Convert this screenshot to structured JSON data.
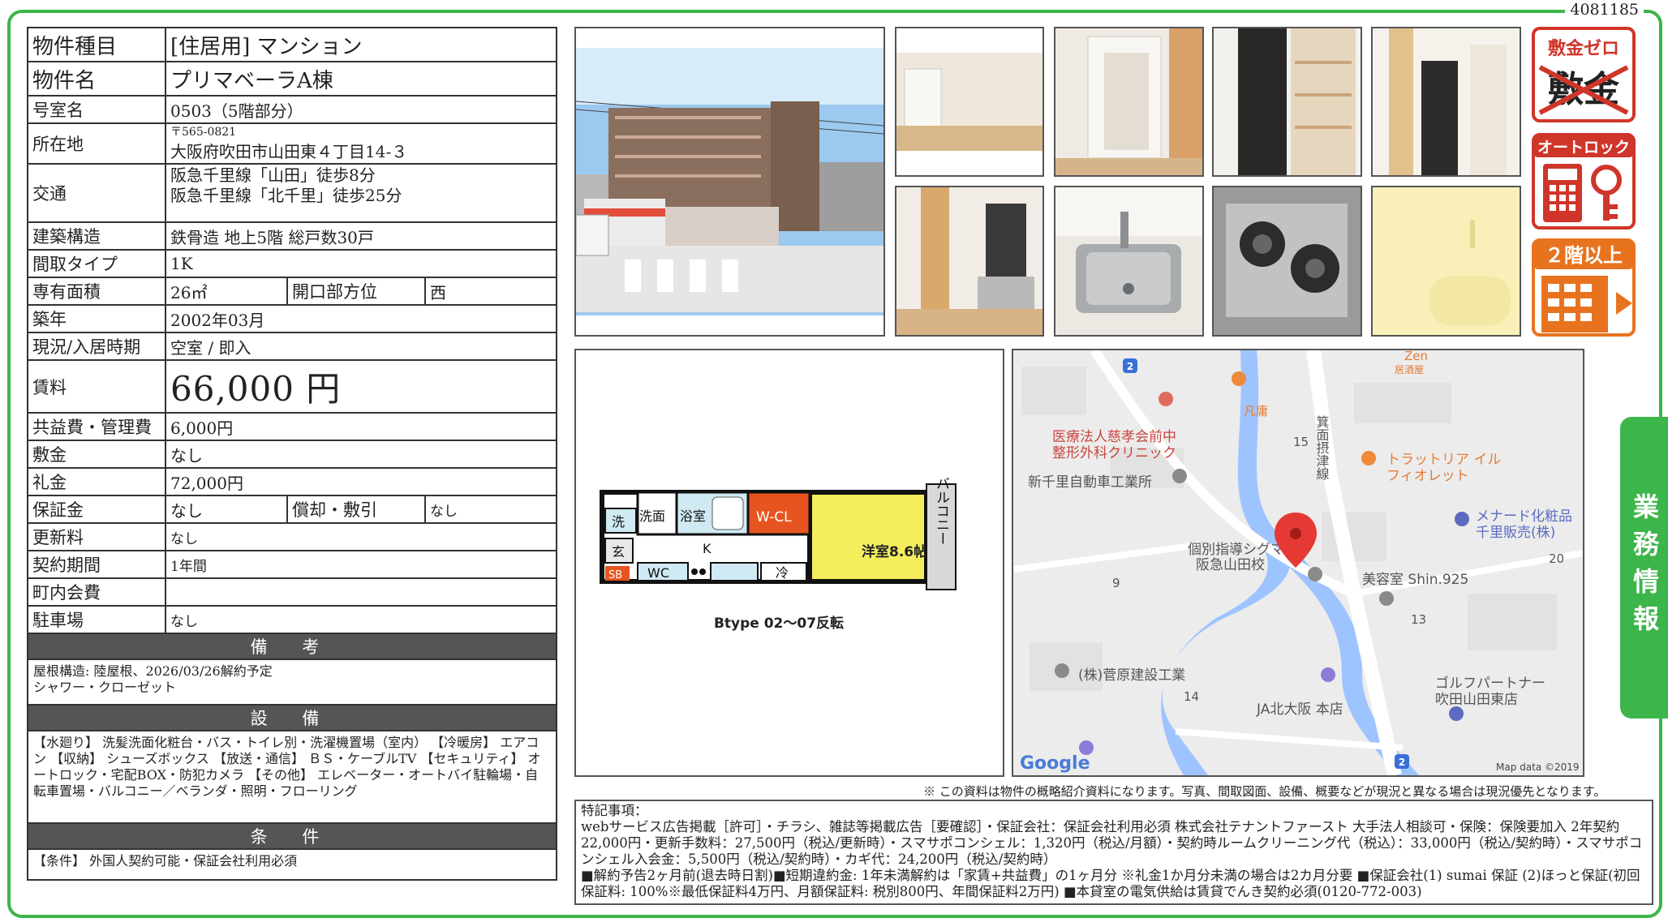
{
  "doc_id": "4081185",
  "property": {
    "type_label": "物件種目",
    "type_value": "[住居用]  マンション",
    "name_label": "物件名",
    "name_value": "プリマベーラA棟",
    "room_label": "号室名",
    "room_value": "0503（5階部分）",
    "address_label": "所在地",
    "address_zip": "〒565-0821",
    "address_value": "大阪府吹田市山田東４丁目14-３",
    "access_label": "交通",
    "access_line1": "阪急千里線「山田」徒歩8分",
    "access_line2": "阪急千里線「北千里」徒歩25分",
    "structure_label": "建築構造",
    "structure_value": "鉄骨造  地上5階  総戸数30戸",
    "layout_label": "間取タイプ",
    "layout_value": "1K",
    "area_label": "専有面積",
    "area_value": "26㎡",
    "opening_label": "開口部方位",
    "opening_value": "西",
    "built_label": "築年",
    "built_value": "2002年03月",
    "status_label": "現況/入居時期",
    "status_value": "空室  /  即入",
    "rent_label": "賃料",
    "rent_value": "66,000  円",
    "fee_label": "共益費・管理費",
    "fee_value": "6,000円",
    "deposit_label": "敷金",
    "deposit_value": "なし",
    "keymoney_label": "礼金",
    "keymoney_value": "72,000円",
    "guarantee_label": "保証金",
    "guarantee_value": "なし",
    "amort_label": "償却・敷引",
    "amort_value": "なし",
    "renewal_label": "更新料",
    "renewal_value": "なし",
    "contract_label": "契約期間",
    "contract_value": "1年間",
    "assoc_label": "町内会費",
    "assoc_value": "",
    "parking_label": "駐車場",
    "parking_value": "なし"
  },
  "remarks": {
    "heading": "備 考",
    "line1": "屋根構造:  陸屋根、2026/03/26解約予定",
    "line2": "シャワー・クローゼット"
  },
  "equipment": {
    "heading": "設 備",
    "text": "【水廻り】 洗髪洗面化粧台・バス・トイレ別・洗濯機置場（室内）  【冷暖房】 エアコン  【収納】 シューズボックス  【放送・通信】 ＢＳ・ケーブルTV 【セキュリティ】 オートロック・宅配BOX・防犯カメラ  【その他】 エレベーター・オートバイ駐輪場・自転車置場・バルコニー／ベランダ・照明・フローリング"
  },
  "conditions": {
    "heading": "条 件",
    "text": "【条件】  外国人契約可能・保証会社利用必須"
  },
  "badges": {
    "deposit_zero": "敷金ゼロ",
    "deposit_word": "敷金",
    "autolock": "オートロック",
    "floor": "２階以上"
  },
  "floorplan": {
    "caption": "Btype 02～07反転",
    "room": "洋室8.6帖",
    "wc_l": "W-CL",
    "bath": "浴室",
    "washroom": "洗面",
    "laundry": "洗",
    "entrance": "玄",
    "kitchen": "K",
    "wc": "WC",
    "fridge": "冷",
    "sb": "SB",
    "balcony": "バルコニー"
  },
  "map": {
    "labels": {
      "zen": "Zen",
      "izakaya": "居酒屋",
      "bonyo": "凡庸",
      "clinic1": "医療法人慈孝会前中",
      "clinic2": "整形外科クリニック",
      "trattoria1": "トラットリア イル",
      "trattoria2": "フィオレット",
      "auto": "新千里自動車工業所",
      "menard1": "メナード化粧品",
      "menard2": "千里販売(株)",
      "sigma1": "個別指導シグマ",
      "sigma2": "阪急山田校",
      "salon": "美容室 Shin.925",
      "sugahara": "(株)菅原建設工業",
      "golf1": "ゴルフパートナー",
      "golf2": "吹田山田東店",
      "ja": "JA北大阪 本店",
      "rail": "箕面摂津線",
      "google": "Google",
      "mapdata": "Map data ©2019",
      "n2a": "2",
      "n2b": "2",
      "n15": "15",
      "n9": "9",
      "n13": "13",
      "n14": "14",
      "n20": "20"
    }
  },
  "disclaimer": "※  この資料は物件の概略紹介資料になります。写真、間取図面、設備、概要などが現況と異なる場合は現況優先となります。",
  "special": {
    "title": "特記事項：",
    "line1": "webサービス広告掲載［許可］・チラシ、雑誌等掲載広告［要確認］・保証会社：保証会社利用必須 株式会社テナントファースト  大手法人相談可・保険：保険要加入 2年契約 22,000円・更新手数料：27,500円（税込/更新時）・スマサポコンシェル：1,320円（税込/月額）・契約時ルームクリーニング代（税込）：33,000円（税込/契約時）・スマサポコンシェル入会金：5,500円（税込/契約時）・カギ代：24,200円（税込/契約時）",
    "line2": "■解約予告2ヶ月前(退去時日割)■短期違約金: 1年未満解約は「家賃+共益費」の1ヶ月分  ※礼金1か月分未満の場合は2カ月分要 ■保証会社(1) sumai 保証  (2)ほっと保証(初回保証料: 100%※最低保証料4万円、月額保証料: 税別800円、年間保証料2万円) ■本貸室の電気供給は賃貸でんき契約必須(0120-772-003)"
  },
  "side_tab": "業務情報",
  "colors": {
    "accent": "#3cb54a",
    "badge_red": "#d0352a",
    "badge_orange": "#e8731f",
    "plan_yellow": "#f4ee5c"
  }
}
